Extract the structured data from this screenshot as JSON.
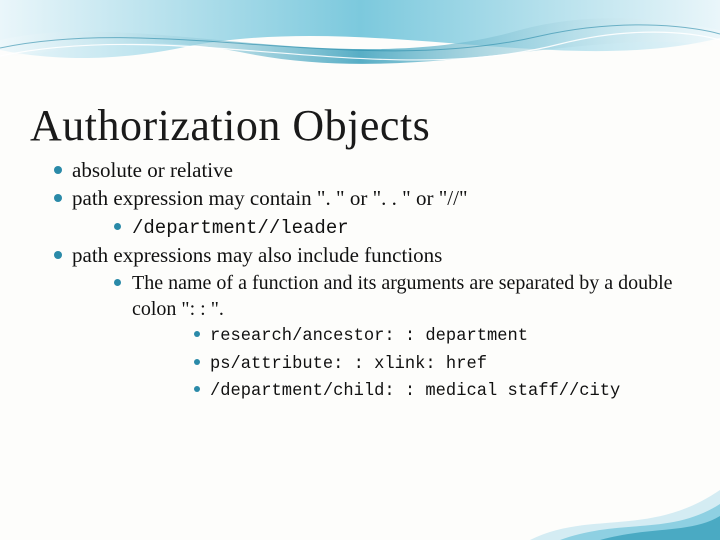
{
  "title": "Authorization Objects",
  "bullets": {
    "b1": "absolute or relative",
    "b2": "path expression may contain \". \" or \". . \" or \"//\"",
    "b2_1": "/department//leader",
    "b3": "path expressions may also include functions",
    "b3_1": "The name of a function and its arguments are separated by a double colon \": : \".",
    "b3_1_1": "research/ancestor: : department",
    "b3_1_2": "ps/attribute: : xlink: href",
    "b3_1_3": "/department/child: : medical staff//city"
  },
  "colors": {
    "bullet": "#2a8aa8",
    "wave_light": "#a8d8e8",
    "wave_mid": "#5bb8d0",
    "wave_dark": "#2a8aa8"
  }
}
